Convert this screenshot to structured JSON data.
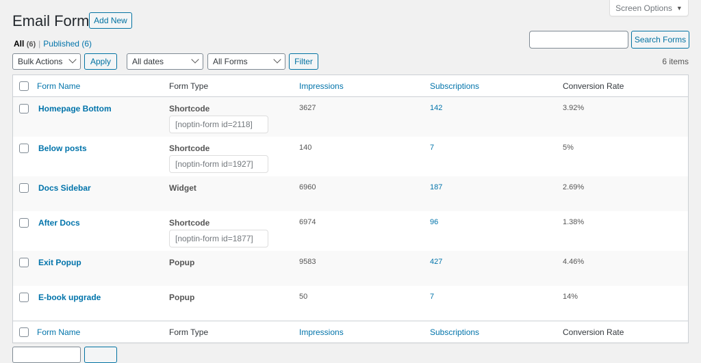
{
  "screen_options": {
    "label": "Screen Options",
    "icon": "triangle-down-icon"
  },
  "header": {
    "title": "Email Forms",
    "add_new_label": "Add New"
  },
  "views": [
    {
      "label": "All",
      "count": "(6)",
      "current": true
    },
    {
      "label": "Published",
      "count": "(6)",
      "current": false
    }
  ],
  "views_separator": "|",
  "filters": {
    "bulk_actions": "Bulk Actions",
    "apply_label": "Apply",
    "dates": "All dates",
    "forms": "All Forms",
    "filter_label": "Filter"
  },
  "search": {
    "value": "",
    "placeholder": "",
    "button_label": "Search Forms"
  },
  "items_count": "6 items",
  "table": {
    "columns": [
      "Form Name",
      "Form Type",
      "Impressions",
      "Subscriptions",
      "Conversion Rate"
    ],
    "rows": [
      {
        "name": "Homepage Bottom",
        "type": "Shortcode",
        "shortcode": "[noptin-form id=2118]",
        "impressions": "3627",
        "subscriptions": "142",
        "conversion": "3.92%"
      },
      {
        "name": "Below posts",
        "type": "Shortcode",
        "shortcode": "[noptin-form id=1927]",
        "impressions": "140",
        "subscriptions": "7",
        "conversion": "5%"
      },
      {
        "name": "Docs Sidebar",
        "type": "Widget",
        "shortcode": null,
        "impressions": "6960",
        "subscriptions": "187",
        "conversion": "2.69%"
      },
      {
        "name": "After Docs",
        "type": "Shortcode",
        "shortcode": "[noptin-form id=1877]",
        "impressions": "6974",
        "subscriptions": "96",
        "conversion": "1.38%"
      },
      {
        "name": "Exit Popup",
        "type": "Popup",
        "shortcode": null,
        "impressions": "9583",
        "subscriptions": "427",
        "conversion": "4.46%"
      },
      {
        "name": "E-book upgrade",
        "type": "Popup",
        "shortcode": null,
        "impressions": "50",
        "subscriptions": "7",
        "conversion": "14%"
      }
    ]
  },
  "colors": {
    "link": "#0073aa",
    "button_border": "#0071a1",
    "background": "#f1f1f1"
  }
}
